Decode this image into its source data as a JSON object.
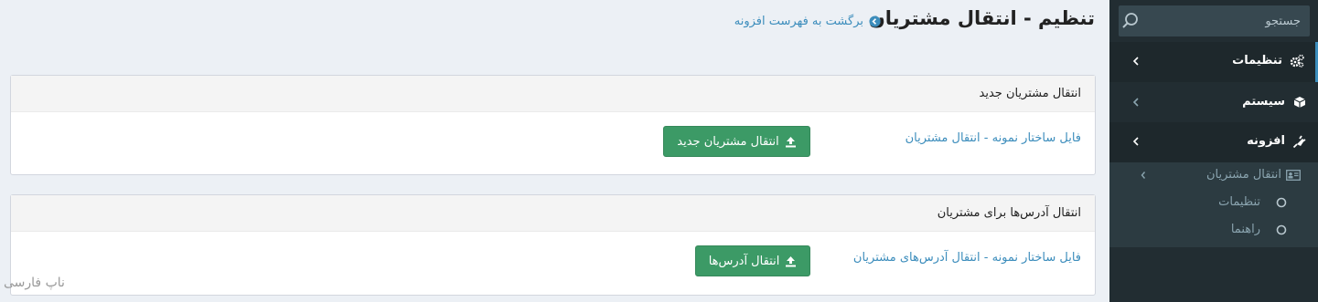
{
  "sidebar": {
    "search_placeholder": "جستجو",
    "menu": [
      {
        "label": "تنظیمات",
        "icon": "gears-icon"
      },
      {
        "label": "سیستم",
        "icon": "cube-icon"
      },
      {
        "label": "افزونه",
        "icon": "plug-icon"
      }
    ],
    "submenu": {
      "parent_label": "انتقال مشتریان",
      "items": [
        "تنظیمات",
        "راهنما"
      ]
    }
  },
  "header": {
    "title": "تنظیم - انتقال مشتریان",
    "back_link": "برگشت به فهرست افزونه"
  },
  "panels": [
    {
      "title": "انتقال مشتریان جدید",
      "sample_link": "فایل ساختار نمونه - انتقال مشتریان",
      "button": "انتقال مشتریان جدید"
    },
    {
      "title": "انتقال آدرس‌ها برای مشتریان",
      "sample_link": "فایل ساختار نمونه - انتقال آدرس‌های مشتریان",
      "button": "انتقال آدرس‌ها"
    }
  ],
  "watermark": "ناپ فارسی",
  "colors": {
    "accent": "#3c8dbc",
    "button": "#3c9a66",
    "sidebar_bg": "#222d32",
    "page_bg": "#ecf0f5"
  }
}
